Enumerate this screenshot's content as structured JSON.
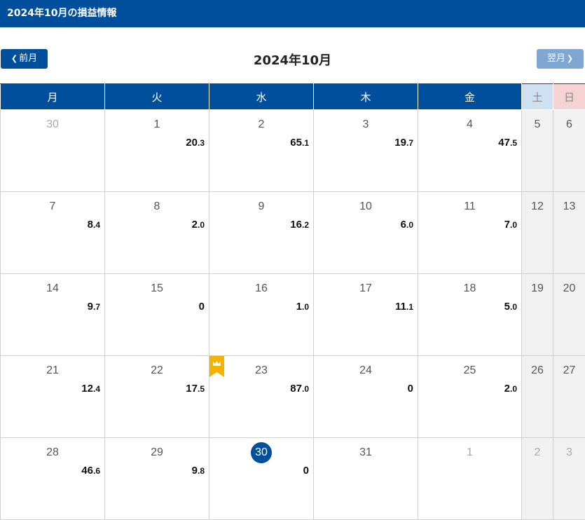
{
  "header": {
    "title": "2024年10月の損益情報"
  },
  "nav": {
    "prev_label": "前月",
    "next_label": "翌月",
    "month_title": "2024年10月"
  },
  "weekdays": [
    "月",
    "火",
    "水",
    "木",
    "金",
    "土",
    "日"
  ],
  "colors": {
    "primary": "#004f9c",
    "next_button": "#7fa7d1",
    "crown": "#f5b301"
  },
  "weeks": [
    [
      {
        "day": "30",
        "other": true,
        "int": "",
        "dec": ""
      },
      {
        "day": "1",
        "int": "20",
        "dec": ".3"
      },
      {
        "day": "2",
        "int": "65",
        "dec": ".1"
      },
      {
        "day": "3",
        "int": "19",
        "dec": ".7"
      },
      {
        "day": "4",
        "int": "47",
        "dec": ".5"
      },
      {
        "day": "5",
        "int": "",
        "dec": ""
      },
      {
        "day": "6",
        "int": "",
        "dec": ""
      }
    ],
    [
      {
        "day": "7",
        "int": "8",
        "dec": ".4"
      },
      {
        "day": "8",
        "int": "2",
        "dec": ".0"
      },
      {
        "day": "9",
        "int": "16",
        "dec": ".2"
      },
      {
        "day": "10",
        "int": "6",
        "dec": ".0"
      },
      {
        "day": "11",
        "int": "7",
        "dec": ".0"
      },
      {
        "day": "12",
        "int": "",
        "dec": ""
      },
      {
        "day": "13",
        "int": "",
        "dec": ""
      }
    ],
    [
      {
        "day": "14",
        "int": "9",
        "dec": ".7"
      },
      {
        "day": "15",
        "int": "0",
        "dec": ""
      },
      {
        "day": "16",
        "int": "1",
        "dec": ".0"
      },
      {
        "day": "17",
        "int": "11",
        "dec": ".1"
      },
      {
        "day": "18",
        "int": "5",
        "dec": ".0"
      },
      {
        "day": "19",
        "int": "",
        "dec": ""
      },
      {
        "day": "20",
        "int": "",
        "dec": ""
      }
    ],
    [
      {
        "day": "21",
        "int": "12",
        "dec": ".4"
      },
      {
        "day": "22",
        "int": "17",
        "dec": ".5"
      },
      {
        "day": "23",
        "int": "87",
        "dec": ".0",
        "crown": true
      },
      {
        "day": "24",
        "int": "0",
        "dec": ""
      },
      {
        "day": "25",
        "int": "2",
        "dec": ".0"
      },
      {
        "day": "26",
        "int": "",
        "dec": ""
      },
      {
        "day": "27",
        "int": "",
        "dec": ""
      }
    ],
    [
      {
        "day": "28",
        "int": "46",
        "dec": ".6"
      },
      {
        "day": "29",
        "int": "9",
        "dec": ".8"
      },
      {
        "day": "30",
        "int": "0",
        "dec": "",
        "today": true
      },
      {
        "day": "31",
        "int": "",
        "dec": ""
      },
      {
        "day": "1",
        "other": true,
        "int": "",
        "dec": ""
      },
      {
        "day": "2",
        "other": true,
        "int": "",
        "dec": ""
      },
      {
        "day": "3",
        "other": true,
        "int": "",
        "dec": ""
      }
    ]
  ]
}
